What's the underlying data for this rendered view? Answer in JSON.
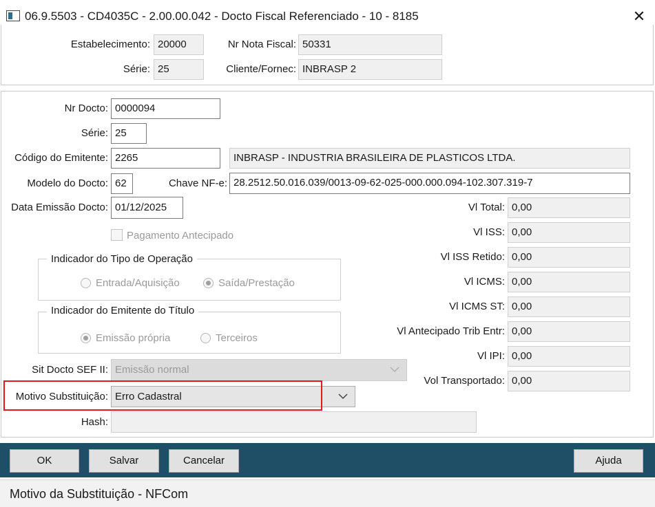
{
  "window": {
    "title": "06.9.5503 - CD4035C - 2.00.00.042 - Docto Fiscal Referenciado - 10 - 8185",
    "close_icon": "close-icon"
  },
  "header": {
    "estabelecimento_label": "Estabelecimento:",
    "estabelecimento_value": "20000",
    "nr_nota_label": "Nr Nota Fiscal:",
    "nr_nota_value": "50331",
    "serie_label": "Série:",
    "serie_value": "25",
    "cliente_label": "Cliente/Fornec:",
    "cliente_value": "INBRASP  2"
  },
  "form": {
    "nr_docto_label": "Nr Docto:",
    "nr_docto_value": "0000094",
    "serie_label": "Série:",
    "serie_value": "25",
    "cod_emitente_label": "Código do Emitente:",
    "cod_emitente_value": "2265",
    "emitente_nome": "INBRASP - INDUSTRIA BRASILEIRA DE PLASTICOS LTDA.",
    "modelo_label": "Modelo do Docto:",
    "modelo_value": "62",
    "chave_label": "Chave NF-e:",
    "chave_value": "28.2512.50.016.039/0013-09-62-025-000.000.094-102.307.319-7",
    "data_emissao_label": "Data Emissão Docto:",
    "data_emissao_value": "01/12/2025",
    "pagamento_antecipado_label": "Pagamento Antecipado",
    "indicador_tipo_title": "Indicador do Tipo de Operação",
    "radio_entrada": "Entrada/Aquisição",
    "radio_saida": "Saída/Prestação",
    "indicador_emitente_title": "Indicador do Emitente do Título",
    "radio_emissao_propria": "Emissão própria",
    "radio_terceiros": "Terceiros",
    "sit_docto_label": "Sit Docto SEF II:",
    "sit_docto_value": "Emissão normal",
    "motivo_label": "Motivo Substituição:",
    "motivo_value": "Erro Cadastral",
    "hash_label": "Hash:",
    "hash_value": ""
  },
  "values": [
    {
      "label": "Vl Total:",
      "value": "0,00"
    },
    {
      "label": "Vl ISS:",
      "value": "0,00"
    },
    {
      "label": "Vl ISS Retido:",
      "value": "0,00"
    },
    {
      "label": "Vl ICMS:",
      "value": "0,00"
    },
    {
      "label": "Vl ICMS ST:",
      "value": "0,00"
    },
    {
      "label": "Vl Antecipado Trib Entr:",
      "value": "0,00"
    },
    {
      "label": "Vl IPI:",
      "value": "0,00"
    },
    {
      "label": "Vol Transportado:",
      "value": "0,00"
    }
  ],
  "toolbar": {
    "ok_label": "OK",
    "salvar_label": "Salvar",
    "cancelar_label": "Cancelar",
    "ajuda_label": "Ajuda"
  },
  "status": {
    "text": "Motivo da Substituição - NFCom"
  },
  "colors": {
    "toolbar_bg": "#1e4f66",
    "highlight": "#e0191d"
  }
}
